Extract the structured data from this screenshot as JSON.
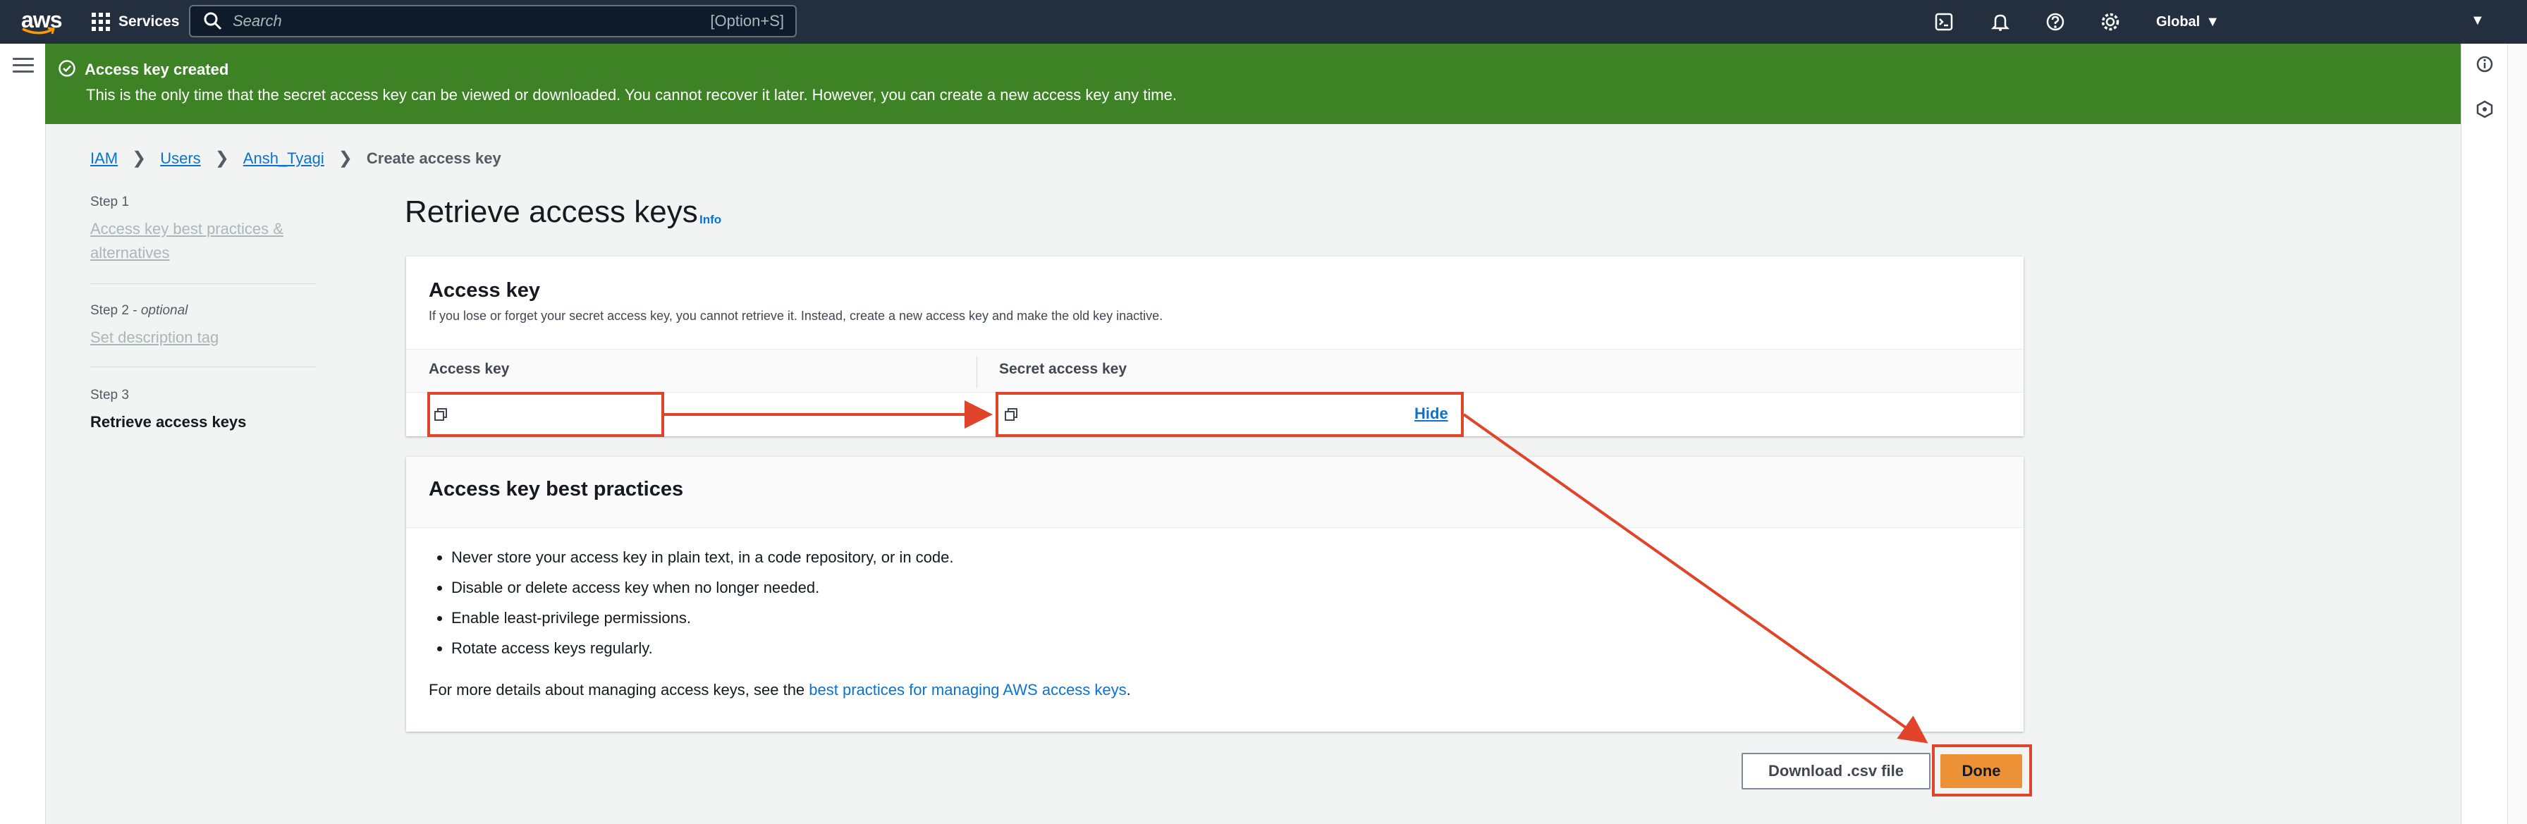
{
  "nav": {
    "logo": "aws",
    "services_label": "Services",
    "search_placeholder": "Search",
    "search_shortcut": "[Option+S]",
    "region": "Global",
    "icons": [
      "cloudshell-icon",
      "bell-icon",
      "help-icon",
      "settings-icon"
    ]
  },
  "flash": {
    "title": "Access key created",
    "message": "This is the only time that the secret access key can be viewed or downloaded. You cannot recover it later. However, you can create a new access key any time.",
    "color": "#3d8224"
  },
  "breadcrumb": {
    "items": [
      "IAM",
      "Users",
      "Ansh_Tyagi"
    ],
    "current": "Create access key"
  },
  "steps": [
    {
      "label": "Step 1",
      "title_line1": "Access key best practices &",
      "title_line2": "alternatives"
    },
    {
      "label": "Step 2",
      "label_suffix": "optional",
      "title": "Set description tag"
    },
    {
      "label": "Step 3",
      "title": "Retrieve access keys"
    }
  ],
  "page": {
    "title": "Retrieve access keys",
    "info": "Info"
  },
  "access_key_card": {
    "title": "Access key",
    "description": "If you lose or forget your secret access key, you cannot retrieve it. Instead, create a new access key and make the old key inactive.",
    "col_access_key": "Access key",
    "col_secret_key": "Secret access key",
    "access_key_value": "",
    "secret_key_value": "",
    "hide_label": "Hide"
  },
  "best_practices": {
    "title": "Access key best practices",
    "items": [
      "Never store your access key in plain text, in a code repository, or in code.",
      "Disable or delete access key when no longer needed.",
      "Enable least-privilege permissions.",
      "Rotate access keys regularly."
    ],
    "more_prefix": "For more details about managing access keys, see the ",
    "more_link": "best practices for managing AWS access keys",
    "more_suffix": "."
  },
  "actions": {
    "download_label": "Download .csv file",
    "done_label": "Done",
    "primary_color": "#ec9135"
  },
  "annotation_color": "#e0442a"
}
